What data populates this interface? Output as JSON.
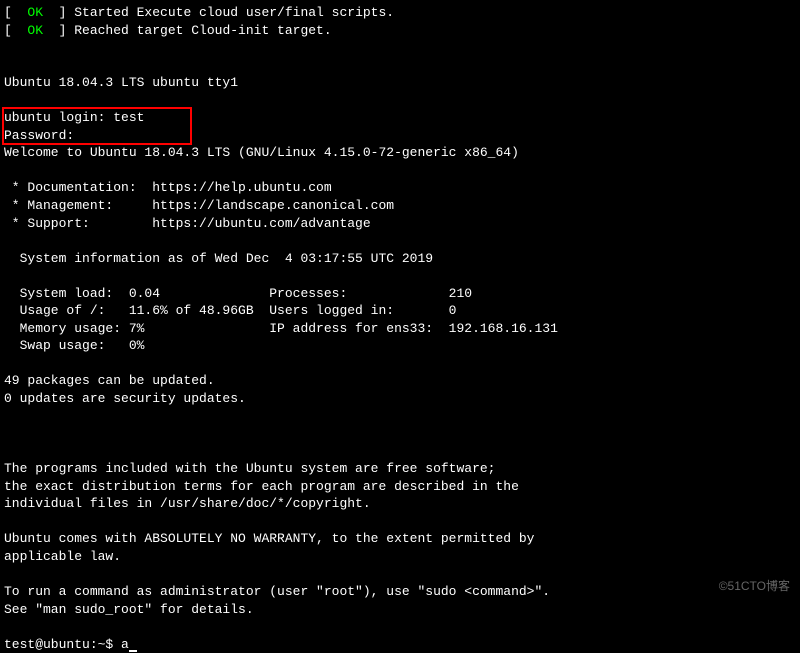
{
  "boot": {
    "line1_prefix": "[  ",
    "line1_ok": "OK",
    "line1_suffix": "  ] Started Execute cloud user/final scripts.",
    "line2_prefix": "[  ",
    "line2_ok": "OK",
    "line2_suffix": "  ] Reached target Cloud-init target."
  },
  "os_banner": "Ubuntu 18.04.3 LTS ubuntu tty1",
  "login": {
    "prompt": "ubuntu login: ",
    "username": "test",
    "password_prompt": "Password:"
  },
  "welcome": "Welcome to Ubuntu 18.04.3 LTS (GNU/Linux 4.15.0-72-generic x86_64)",
  "links": {
    "doc": " * Documentation:  https://help.ubuntu.com",
    "mgmt": " * Management:     https://landscape.canonical.com",
    "support": " * Support:        https://ubuntu.com/advantage"
  },
  "sysinfo_header": "  System information as of Wed Dec  4 03:17:55 UTC 2019",
  "sysinfo": {
    "l1": "  System load:  0.04              Processes:             210",
    "l2": "  Usage of /:   11.6% of 48.96GB  Users logged in:       0",
    "l3": "  Memory usage: 7%                IP address for ens33:  192.168.16.131",
    "l4": "  Swap usage:   0%"
  },
  "updates": {
    "l1": "49 packages can be updated.",
    "l2": "0 updates are security updates."
  },
  "legal": {
    "l1": "The programs included with the Ubuntu system are free software;",
    "l2": "the exact distribution terms for each program are described in the",
    "l3": "individual files in /usr/share/doc/*/copyright.",
    "l4": "Ubuntu comes with ABSOLUTELY NO WARRANTY, to the extent permitted by",
    "l5": "applicable law."
  },
  "sudo_hint": {
    "l1": "To run a command as administrator (user \"root\"), use \"sudo <command>\".",
    "l2": "See \"man sudo_root\" for details."
  },
  "shell": {
    "prompt": "test@ubuntu:~$ ",
    "input": "a"
  },
  "watermark": "©51CTO博客"
}
